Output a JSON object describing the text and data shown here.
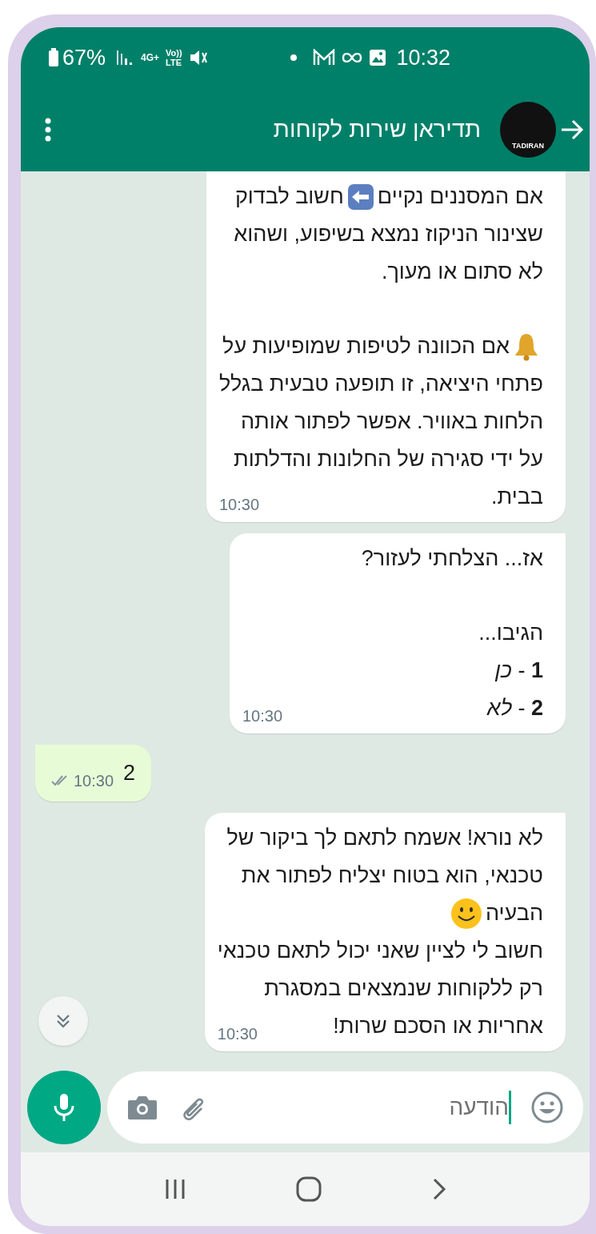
{
  "status_bar": {
    "battery": "67%",
    "network": "4G+",
    "volte": "Vo))",
    "lte": "LTE",
    "time": "10:32"
  },
  "header": {
    "avatar_text": "TADIRAN",
    "title": "תדיראן שירות לקוחות"
  },
  "messages": [
    {
      "kind": "incoming",
      "cut_top": true,
      "lines": [
        {
          "kind": "text",
          "parts": [
            {
              "kind": "text",
              "text": "אם המסננים נקיים"
            },
            {
              "kind": "arrow-emoji"
            },
            {
              "kind": "text",
              "text": "חשוב לבדוק"
            }
          ]
        },
        {
          "kind": "text",
          "parts": [
            {
              "kind": "text",
              "text": "שצינור הניקוז נמצא בשיפוע, ושהוא"
            }
          ]
        },
        {
          "kind": "text",
          "parts": [
            {
              "kind": "text",
              "text": "לא סתום או מעוך."
            }
          ]
        },
        {
          "kind": "gap"
        },
        {
          "kind": "text",
          "parts": [
            {
              "kind": "bell-emoji"
            },
            {
              "kind": "text",
              "text": "אם הכוונה לטיפות שמופיעות על"
            }
          ]
        },
        {
          "kind": "text",
          "parts": [
            {
              "kind": "text",
              "text": "פתחי היציאה, זו תופעה טבעית בגלל"
            }
          ]
        },
        {
          "kind": "text",
          "parts": [
            {
              "kind": "text",
              "text": "הלחות באוויר. אפשר לפתור אותה"
            }
          ]
        },
        {
          "kind": "text",
          "parts": [
            {
              "kind": "text",
              "text": "על ידי סגירה של החלונות והדלתות"
            }
          ]
        },
        {
          "kind": "text",
          "parts": [
            {
              "kind": "text",
              "text": "בבית."
            }
          ]
        }
      ],
      "time": "10:30"
    },
    {
      "kind": "incoming",
      "lines": [
        {
          "kind": "text",
          "parts": [
            {
              "kind": "text",
              "text": "אז... הצלחתי לעזור?"
            }
          ]
        },
        {
          "kind": "gap"
        },
        {
          "kind": "text",
          "parts": [
            {
              "kind": "text",
              "text": "הגיבו..."
            }
          ]
        },
        {
          "kind": "text",
          "parts": [
            {
              "kind": "text",
              "text": "**1** - *כן*"
            }
          ]
        },
        {
          "kind": "text",
          "parts": [
            {
              "kind": "text",
              "text": "**2** - *לא*"
            }
          ]
        }
      ],
      "time": "10:30"
    },
    {
      "kind": "outgoing",
      "delivered": true,
      "read": false,
      "lines": [
        {
          "kind": "text",
          "parts": [
            {
              "kind": "text",
              "text": "2"
            }
          ]
        }
      ],
      "time": "10:30"
    },
    {
      "kind": "incoming",
      "lines": [
        {
          "kind": "text",
          "parts": [
            {
              "kind": "text",
              "text": "לא נורא! אשמח לתאם לך ביקור של"
            }
          ]
        },
        {
          "kind": "text",
          "parts": [
            {
              "kind": "text",
              "text": "טכנאי, הוא בטוח יצליח לפתור את"
            }
          ]
        },
        {
          "kind": "text",
          "parts": [
            {
              "kind": "text",
              "text": "הבעיה"
            },
            {
              "kind": "smile-emoji"
            }
          ]
        },
        {
          "kind": "text",
          "parts": [
            {
              "kind": "text",
              "text": "חשוב לי לציין שאני יכול לתאם טכנאי"
            }
          ]
        },
        {
          "kind": "text",
          "parts": [
            {
              "kind": "text",
              "text": "רק ללקוחות שנמצאים במסגרת"
            }
          ]
        },
        {
          "kind": "text",
          "parts": [
            {
              "kind": "text",
              "text": "אחריות או הסכם שרות!"
            }
          ]
        }
      ],
      "time": "10:30"
    }
  ],
  "composer": {
    "placeholder": "הודעה"
  }
}
